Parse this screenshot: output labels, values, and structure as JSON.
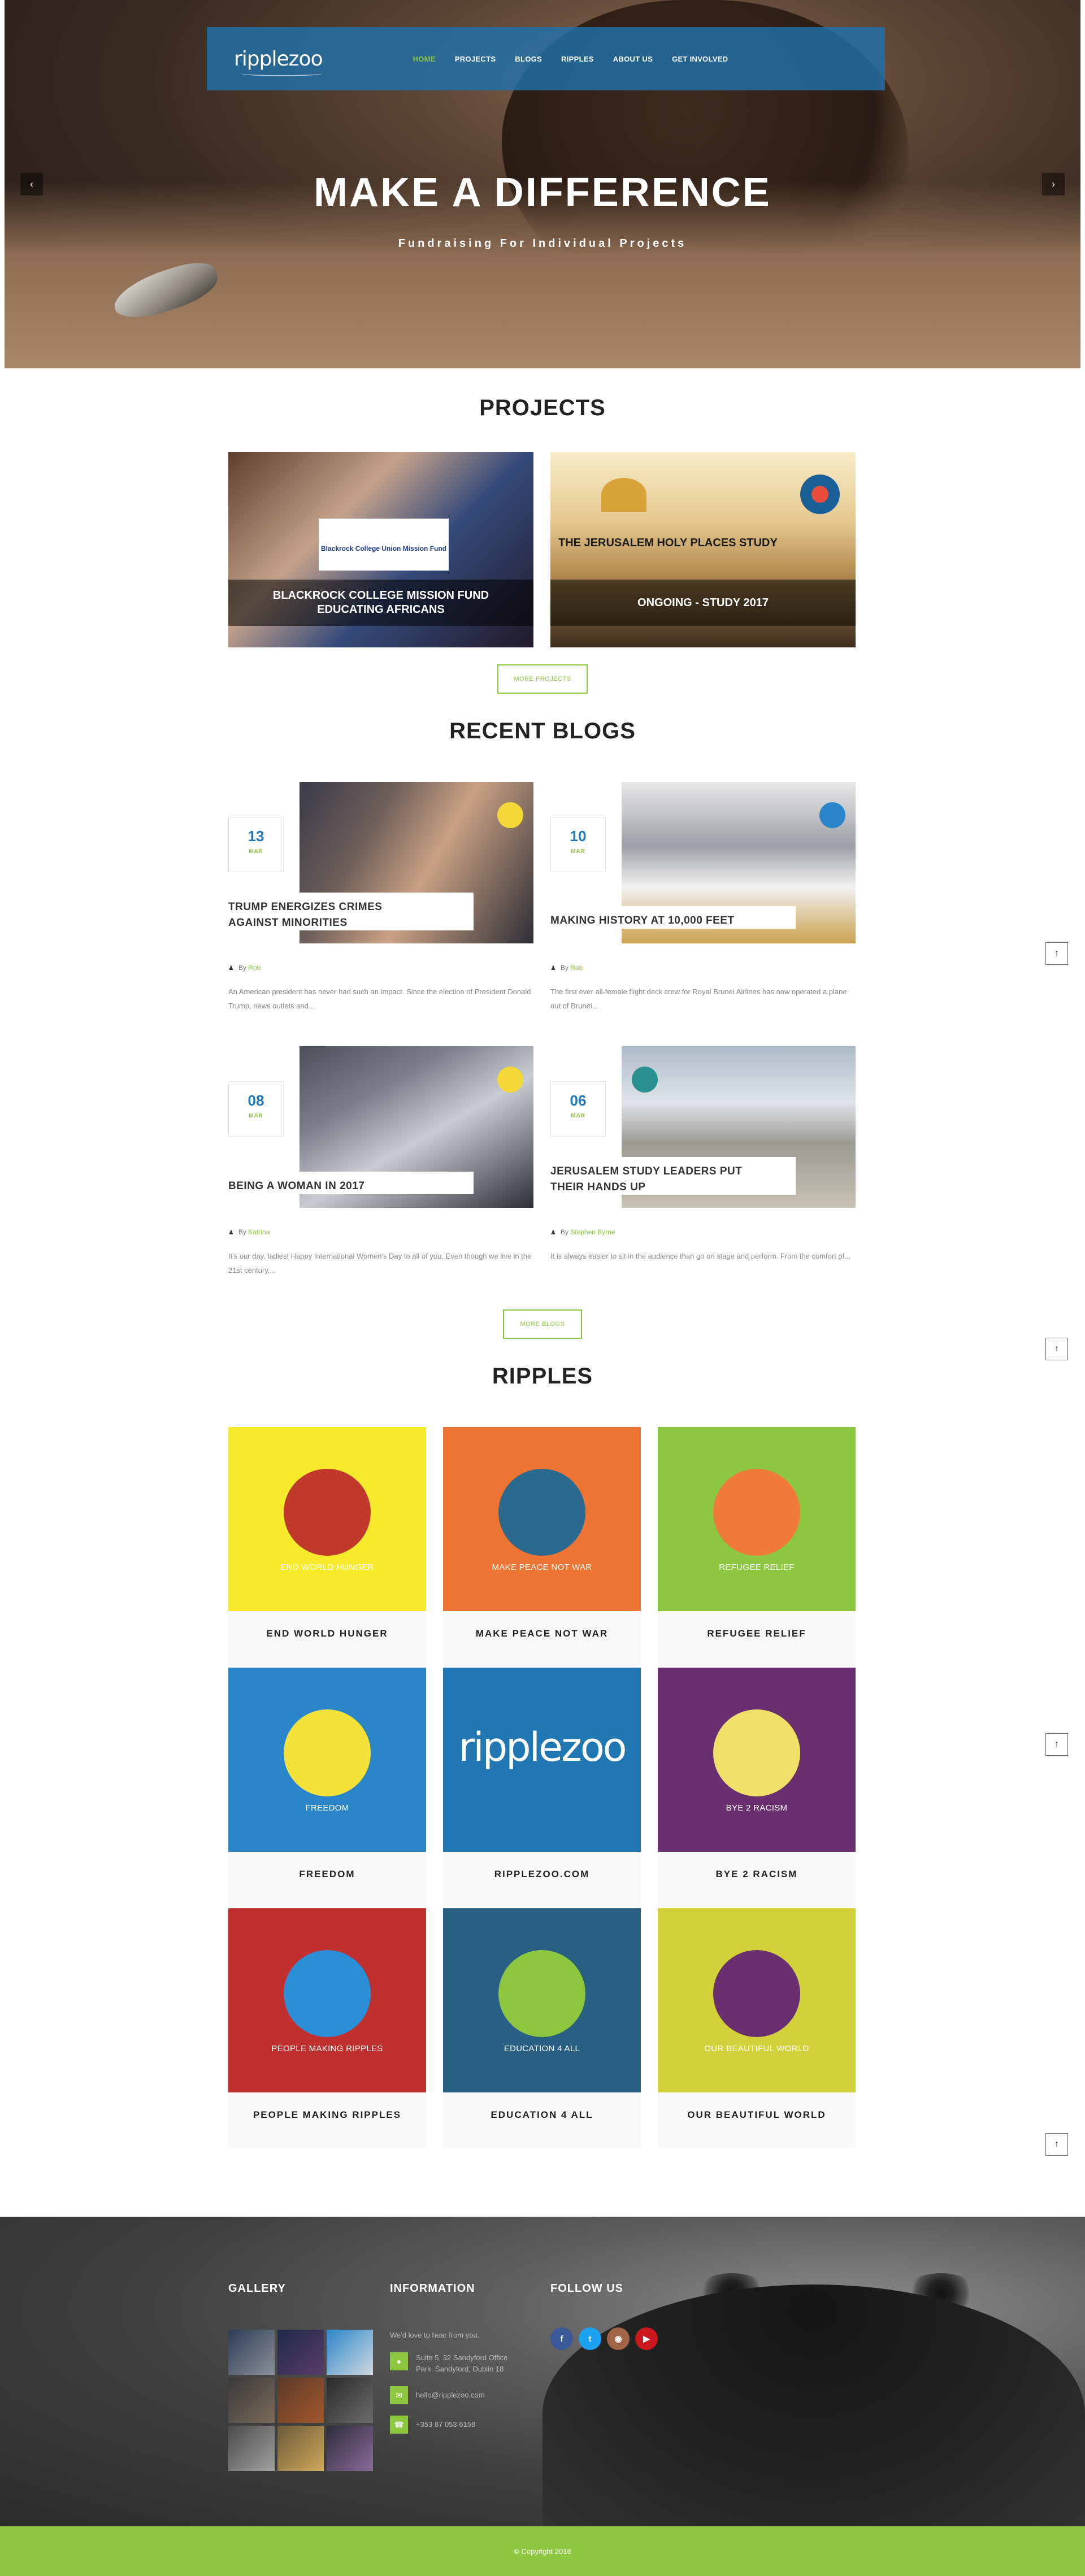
{
  "header": {
    "logo": "ripplezoo",
    "nav": [
      "HOME",
      "PROJECTS",
      "BLOGS",
      "RIPPLES",
      "ABOUT US",
      "GET INVOLVED"
    ]
  },
  "hero": {
    "title": "MAKE A DIFFERENCE",
    "subtitle": "Fundraising For Individual Projects",
    "prev_icon": "chevron-left-icon",
    "next_icon": "chevron-right-icon"
  },
  "projects": {
    "title": "PROJECTS",
    "items": [
      {
        "caption": "BLACKROCK COLLEGE MISSION FUND EDUCATING AFRICANS",
        "card_text": "Blackrock College Union Mission Fund"
      },
      {
        "caption": "ONGOING - STUDY 2017",
        "image_title": "THE JERUSALEM HOLY PLACES STUDY"
      }
    ],
    "more_label": "MORE PROJECTS"
  },
  "blogs": {
    "title": "RECENT BLOGS",
    "by_label": "By",
    "items": [
      {
        "day": "13",
        "month": "MAR",
        "title": "TRUMP ENERGIZES CRIMES AGAINST MINORITIES",
        "author": "Rob",
        "excerpt": "An American president has never had such an impact. Since the election of President Donald Trump, news outlets and..."
      },
      {
        "day": "10",
        "month": "MAR",
        "title": "MAKING HISTORY AT 10,000 FEET",
        "author": "Rob",
        "excerpt": "The first ever all-female flight deck crew for Royal Brunei Airlines has now operated a plane out of Brunei..."
      },
      {
        "day": "08",
        "month": "MAR",
        "title": "BEING A WOMAN IN 2017",
        "author": "Katrina",
        "excerpt": "It's our day, ladies! Happy International Women's Day to all of you. Even though we live in the 21st century,..."
      },
      {
        "day": "06",
        "month": "MAR",
        "title": "JERUSALEM STUDY LEADERS PUT THEIR HANDS UP",
        "author": "Stephen Byrne",
        "excerpt": "It is always easier to sit in the audience than go on stage and perform. From the comfort of..."
      }
    ],
    "more_label": "MORE BLOGS"
  },
  "ripples": {
    "title": "RIPPLES",
    "items": [
      {
        "tile_label": "END WORLD HUNGER",
        "name": "END WORLD HUNGER",
        "bg": "#f6ea2a",
        "circle": "#c0392b"
      },
      {
        "tile_label": "MAKE PEACE NOT WAR",
        "name": "MAKE PEACE NOT WAR",
        "bg": "#ee7433",
        "circle": "#2b6a8e"
      },
      {
        "tile_label": "REFUGEE RELIEF",
        "name": "REFUGEE RELIEF",
        "bg": "#8dc63f",
        "circle": "#f07a3a"
      },
      {
        "tile_label": "FREEDOM",
        "name": "FREEDOM",
        "bg": "#2b86c9",
        "circle": "#f4e23b"
      },
      {
        "tile_label": "",
        "name": "RIPPLEZOO.COM",
        "bg": "#2077b1",
        "circle": "",
        "brand": "ripplezoo"
      },
      {
        "tile_label": "BYE 2 RACISM",
        "name": "BYE 2 RACISM",
        "bg": "#6a2f6e",
        "circle": "#efe06a"
      },
      {
        "tile_label": "PEOPLE MAKING RIPPLES",
        "name": "PEOPLE MAKING RIPPLES",
        "bg": "#c0302f",
        "circle": "#2a8fd6"
      },
      {
        "tile_label": "EDUCATION 4 ALL",
        "name": "EDUCATION 4 ALL",
        "bg": "#285f83",
        "circle": "#8dc63f"
      },
      {
        "tile_label": "OUR BEAUTIFUL WORLD",
        "name": "OUR BEAUTIFUL WORLD",
        "bg": "#d2d13a",
        "circle": "#6a2f6e"
      }
    ]
  },
  "footer": {
    "gallery_title": "GALLERY",
    "information_title": "INFORMATION",
    "follow_title": "FOLLOW US",
    "intro": "We'd love to hear from you.",
    "address": "Suite 5, 32 Sandyford Office Park, Sandyford, Dublin 18",
    "email": "hello@ripplezoo.com",
    "phone": "+353 87 053 6158",
    "social_icons": [
      "facebook-icon",
      "twitter-icon",
      "instagram-icon",
      "youtube-icon"
    ],
    "social_colors": [
      "#3b5998",
      "#1da1f2",
      "#a06548",
      "#cc181e"
    ],
    "copyright": "© Copyright 2016"
  },
  "colors": {
    "accent": "#8dc63f",
    "brand_blue": "#1f77b8"
  }
}
